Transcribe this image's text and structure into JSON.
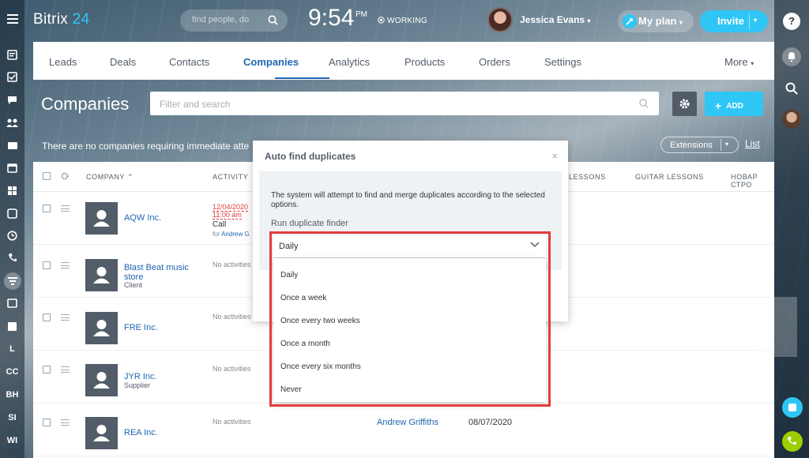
{
  "app": {
    "logo_text": "Bitrix",
    "logo_num": "24"
  },
  "topbar": {
    "search_placeholder": "find people, do",
    "time": "9:54",
    "ampm": "PM",
    "status": "WORKING",
    "user_name": "Jessica Evans",
    "my_plan": "My plan",
    "invite": "Invite"
  },
  "left_sidebar": {
    "labels": [
      "L",
      "CC",
      "BH",
      "SI",
      "WI"
    ]
  },
  "nav": {
    "tabs": [
      "Leads",
      "Deals",
      "Contacts",
      "Companies",
      "Analytics",
      "Products",
      "Orders",
      "Settings"
    ],
    "active": "Companies",
    "more": "More"
  },
  "page": {
    "title": "Companies",
    "filter_placeholder": "Filter and search",
    "add_label": "ADD",
    "notice": "There are no companies requiring immediate atte",
    "extensions": "Extensions",
    "list_view": "List"
  },
  "grid": {
    "headers": [
      "COMPANY",
      "ACTIVITY",
      "LESSONS",
      "GUITAR LESSONS",
      "НОВАР СТРО"
    ],
    "rows": [
      {
        "name": "AQW Inc.",
        "type": "",
        "activity_date": "12/04/2020",
        "activity_time": "11:00 am",
        "activity_kind": "Call",
        "activity_for_prefix": "for",
        "activity_for": "Andrew G",
        "responsible": "",
        "date": ""
      },
      {
        "name": "Blast Beat music store",
        "type": "Client",
        "activity": "No activities",
        "responsible": "",
        "date": ""
      },
      {
        "name": "FRE Inc.",
        "type": "",
        "activity": "No activities",
        "responsible": "",
        "date": ""
      },
      {
        "name": "JYR Inc.",
        "type": "Supplier",
        "activity": "No activities",
        "responsible": "",
        "date": ""
      },
      {
        "name": "REA Inc.",
        "type": "",
        "activity": "No activities",
        "responsible": "Andrew Griffiths",
        "date": "08/07/2020"
      }
    ]
  },
  "modal": {
    "title": "Auto find duplicates",
    "description": "The system will attempt to find and merge duplicates according to the selected options.",
    "field_label": "Run duplicate finder",
    "selected": "Daily",
    "options": [
      "Daily",
      "Once a week",
      "Once every two weeks",
      "Once a month",
      "Once every six months",
      "Never"
    ]
  },
  "colors": {
    "accent": "#2fc6f6",
    "link": "#2067b0",
    "highlight_border": "#e33d3d"
  }
}
